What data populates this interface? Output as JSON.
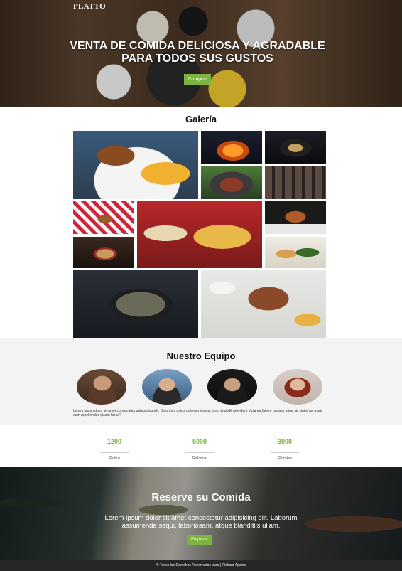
{
  "hero": {
    "brand": "PLATTO",
    "title": "VENTA DE COMIDA DELICIOSA Y AGRADABLE PARA TODOS SUS GUSTOS",
    "button_label": "Comprar"
  },
  "gallery": {
    "title": "Galería",
    "images": [
      {
        "subject": "burger-and-fries"
      },
      {
        "subject": "grill-fire"
      },
      {
        "subject": "plated-dish"
      },
      {
        "subject": "grill-skewers"
      },
      {
        "subject": "grill-burgers"
      },
      {
        "subject": "burger-picnic"
      },
      {
        "subject": "hot-dogs-and-fries"
      },
      {
        "subject": "stacked-burger"
      },
      {
        "subject": "noodle-bowl"
      },
      {
        "subject": "snack-plate"
      },
      {
        "subject": "clams-pan"
      },
      {
        "subject": "table-spread"
      }
    ]
  },
  "team": {
    "title": "Nuestro Equipo",
    "members": [
      {
        "avatar": "member-1"
      },
      {
        "avatar": "member-2"
      },
      {
        "avatar": "member-3"
      },
      {
        "avatar": "member-4"
      }
    ],
    "text": "Lorem ipsum dolor sit amet consectetur adipisicing elit. Doloribus natus dolorum tenetur iusto impedit provident dicta ea facere pariatur vitae, at sint error a qui eum repellendus ipsum hic ut?"
  },
  "stats": [
    {
      "value": "1200",
      "label": "Orden"
    },
    {
      "value": "5000",
      "label": "Delivery"
    },
    {
      "value": "3000",
      "label": "Clientes"
    }
  ],
  "reserve": {
    "title": "Reserve su Comida",
    "text": "Lorem ipsum dolor sit amet consectetur adipisicing elit. Laborum assumenda sequi, laboriosam, atque blanditiis ullam.",
    "button_label": "Empezar"
  },
  "footer": {
    "text": "© Todos los Derechos Reservados para | Richard Apaico"
  },
  "colors": {
    "accent": "#7cb342",
    "footer_bg": "#262626",
    "team_bg": "#f3f3f3"
  }
}
